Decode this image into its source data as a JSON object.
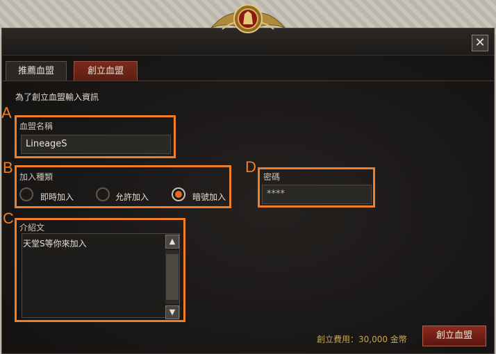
{
  "window": {
    "close_label": "✕"
  },
  "tabs": [
    {
      "label": "推薦血盟",
      "active": false
    },
    {
      "label": "創立血盟",
      "active": true
    }
  ],
  "subtitle": "為了創立血盟輸入資訊",
  "annotations": {
    "a": "A",
    "b": "B",
    "c": "C",
    "d": "D"
  },
  "accent_color": "#f07f2a",
  "clan_name": {
    "label": "血盟名稱",
    "value": "LineageS"
  },
  "join_type": {
    "label": "加入種類",
    "options": [
      "即時加入",
      "允許加入",
      "暗號加入"
    ],
    "selected": "暗號加入"
  },
  "password": {
    "label": "密碼",
    "value": "****"
  },
  "intro": {
    "label": "介紹文",
    "value": "天堂S等你來加入"
  },
  "scroll": {
    "up": "▲",
    "down": "▼"
  },
  "footer": {
    "cost": "創立費用：30,000 金幣",
    "create_label": "創立血盟"
  }
}
